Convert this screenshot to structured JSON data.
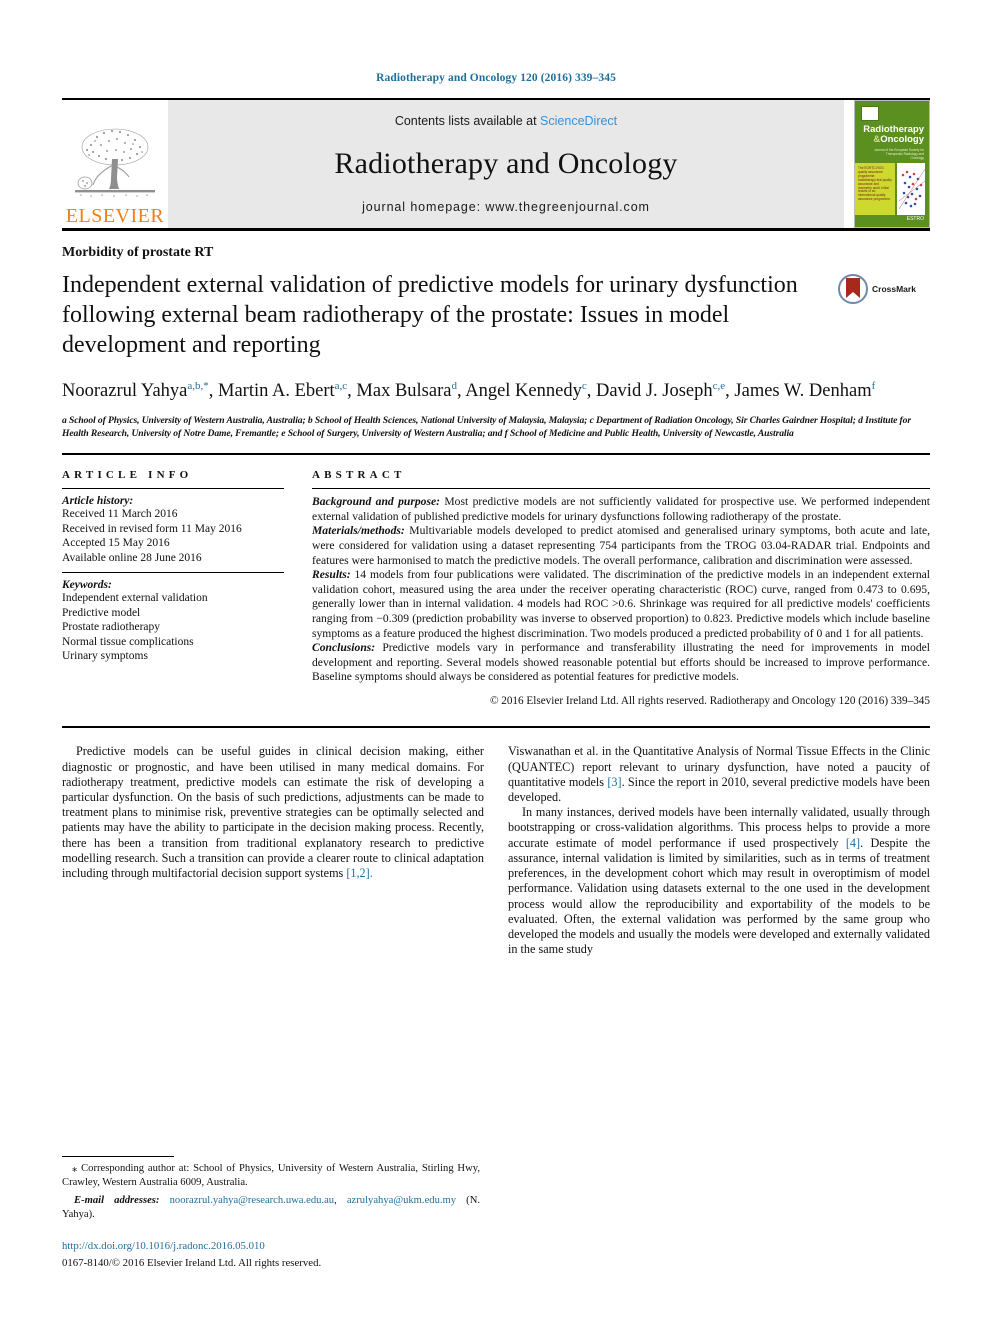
{
  "running_head": "Radiotherapy and Oncology 120 (2016) 339–345",
  "masthead": {
    "publisher_logo_text": "ELSEVIER",
    "contents_prefix": "Contents lists available at ",
    "contents_link": "ScienceDirect",
    "journal_name": "Radiotherapy and Oncology",
    "homepage_line": "journal homepage: www.thegreenjournal.com",
    "cover": {
      "title_line1": "Radiotherapy",
      "title_amp": "&",
      "title_line2": "Oncology",
      "subtitle": "Journal of the European Society for Therapeutic Radiology and Oncology",
      "panel_text": "The EORTC‑ROG quality assurance programme: radiotherapy trial quality assurance and dosimetry audit. Initial results of an international quality assurance programme.",
      "footer_mark": "ESTRO"
    }
  },
  "section_kicker": "Morbidity of prostate RT",
  "title": "Independent external validation of predictive models for urinary dysfunction following external beam radiotherapy of the prostate: Issues in model development and reporting",
  "crossmark_label": "CrossMark",
  "authors": [
    {
      "name": "Noorazrul Yahya",
      "sup": "a,b,*"
    },
    {
      "name": "Martin A. Ebert",
      "sup": "a,c"
    },
    {
      "name": "Max Bulsara",
      "sup": "d"
    },
    {
      "name": "Angel Kennedy",
      "sup": "c"
    },
    {
      "name": "David J. Joseph",
      "sup": "c,e"
    },
    {
      "name": "James W. Denham",
      "sup": "f"
    }
  ],
  "affiliations": "a School of Physics, University of Western Australia, Australia; b School of Health Sciences, National University of Malaysia, Malaysia; c Department of Radiation Oncology, Sir Charles Gairdner Hospital; d Institute for Health Research, University of Notre Dame, Fremantle; e School of Surgery, University of Western Australia; and f School of Medicine and Public Health, University of Newcastle, Australia",
  "article_info": {
    "heading": "ARTICLE INFO",
    "history_label": "Article history:",
    "history": [
      "Received 11 March 2016",
      "Received in revised form 11 May 2016",
      "Accepted 15 May 2016",
      "Available online 28 June 2016"
    ],
    "keywords_label": "Keywords:",
    "keywords": [
      "Independent external validation",
      "Predictive model",
      "Prostate radiotherapy",
      "Normal tissue complications",
      "Urinary symptoms"
    ]
  },
  "abstract": {
    "heading": "ABSTRACT",
    "sections": [
      {
        "label": "Background and purpose:",
        "text": " Most predictive models are not sufficiently validated for prospective use. We performed independent external validation of published predictive models for urinary dysfunctions following radiotherapy of the prostate."
      },
      {
        "label": "Materials/methods:",
        "text": " Multivariable models developed to predict atomised and generalised urinary symptoms, both acute and late, were considered for validation using a dataset representing 754 participants from the TROG 03.04-RADAR trial. Endpoints and features were harmonised to match the predictive models. The overall performance, calibration and discrimination were assessed."
      },
      {
        "label": "Results:",
        "text": " 14 models from four publications were validated. The discrimination of the predictive models in an independent external validation cohort, measured using the area under the receiver operating characteristic (ROC) curve, ranged from 0.473 to 0.695, generally lower than in internal validation. 4 models had ROC >0.6. Shrinkage was required for all predictive models' coefficients ranging from −0.309 (prediction probability was inverse to observed proportion) to 0.823. Predictive models which include baseline symptoms as a feature produced the highest discrimination. Two models produced a predicted probability of 0 and 1 for all patients."
      },
      {
        "label": "Conclusions:",
        "text": " Predictive models vary in performance and transferability illustrating the need for improvements in model development and reporting. Several models showed reasonable potential but efforts should be increased to improve performance. Baseline symptoms should always be considered as potential features for predictive models."
      }
    ],
    "copyright": "© 2016 Elsevier Ireland Ltd. All rights reserved. Radiotherapy and Oncology 120 (2016) 339–345"
  },
  "body": {
    "left_paragraphs": [
      "Predictive models can be useful guides in clinical decision making, either diagnostic or prognostic, and have been utilised in many medical domains. For radiotherapy treatment, predictive models can estimate the risk of developing a particular dysfunction. On the basis of such predictions, adjustments can be made to treatment plans to minimise risk, preventive strategies can be optimally selected and patients may have the ability to participate in the decision making process. Recently, there has been a transition from traditional explanatory research to predictive modelling research. Such a transition can provide a clearer route to clinical adaptation including through multifactorial decision support systems ",
      "[1,2]."
    ],
    "left_ref": "[1,2]",
    "right_paragraphs": [
      {
        "pre": "Viswanathan et al. in the Quantitative Analysis of Normal Tissue Effects in the Clinic (QUANTEC) report relevant to urinary dysfunction, have noted a paucity of quantitative models ",
        "ref": "[3]",
        "post": ". Since the report in 2010, several predictive models have been developed."
      },
      {
        "pre": "In many instances, derived models have been internally validated, usually through bootstrapping or cross-validation algorithms. This process helps to provide a more accurate estimate of model performance if used prospectively ",
        "ref": "[4]",
        "post": ". Despite the assurance, internal validation is limited by similarities, such as in terms of treatment preferences, in the development cohort which may result in overoptimism of model performance. Validation using datasets external to the one used in the development process would allow the reproducibility and exportability of the models to be evaluated. Often, the external validation was performed by the same group who developed the models and usually the models were developed and externally validated in the same study"
      }
    ]
  },
  "footnotes": {
    "corresponding_marker": "⁎",
    "corresponding_text": " Corresponding author at: School of Physics, University of Western Australia, Stirling Hwy, Crawley, Western Australia 6009, Australia.",
    "email_label": "E-mail addresses:",
    "email_1": "noorazrul.yahya@research.uwa.edu.au",
    "email_sep": ", ",
    "email_2": "azrulyahya@ukm.edu.my",
    "email_suffix": " (N. Yahya).",
    "doi": "http://dx.doi.org/10.1016/j.radonc.2016.05.010",
    "issn": "0167-8140/© 2016 Elsevier Ireland Ltd. All rights reserved."
  },
  "colors": {
    "link_teal": "#1f6f9b",
    "sciencedirect_blue": "#3b8fd4",
    "elsevier_orange": "#f07f13",
    "cover_green": "#5b8f1f",
    "cover_yellow": "#cdd92e"
  }
}
